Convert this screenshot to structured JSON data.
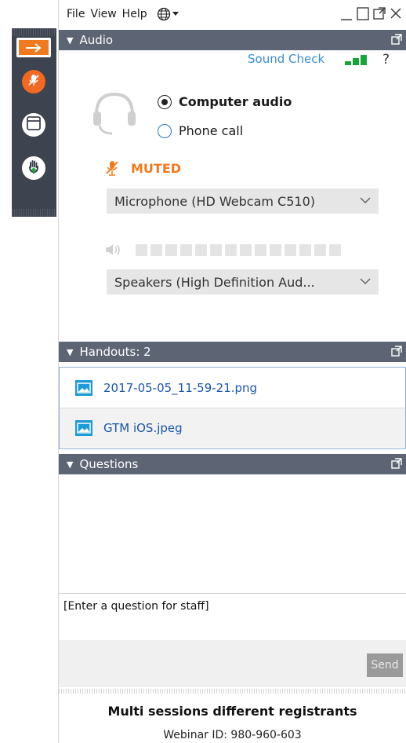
{
  "menubar": {
    "items": [
      "File",
      "View",
      "Help"
    ],
    "language_icon": "globe-icon"
  },
  "audio_panel": {
    "title": "Audio",
    "sound_check": "Sound Check",
    "help": "?",
    "options": [
      {
        "label": "Computer audio",
        "selected": true
      },
      {
        "label": "Phone call",
        "selected": false
      }
    ],
    "mute_status": "MUTED",
    "microphone": "Microphone (HD Webcam C510)",
    "speakers": "Speakers (High Definition Aud...",
    "volume_level": 0
  },
  "handouts_panel": {
    "title": "Handouts: 2",
    "files": [
      {
        "name": "2017-05-05_11-59-21.png"
      },
      {
        "name": "GTM iOS.jpeg"
      }
    ]
  },
  "questions_panel": {
    "title": "Questions",
    "input_placeholder": "[Enter a question for staff]",
    "send_label": "Send"
  },
  "footer": {
    "webinar_title": "Multi sessions different registrants",
    "webinar_id": "Webinar ID: 980-960-603"
  },
  "colors": {
    "accent_orange": "#f07a20",
    "header_gray": "#5d6474",
    "link_blue": "#1a57a8",
    "signal_green": "#1aa33a"
  }
}
